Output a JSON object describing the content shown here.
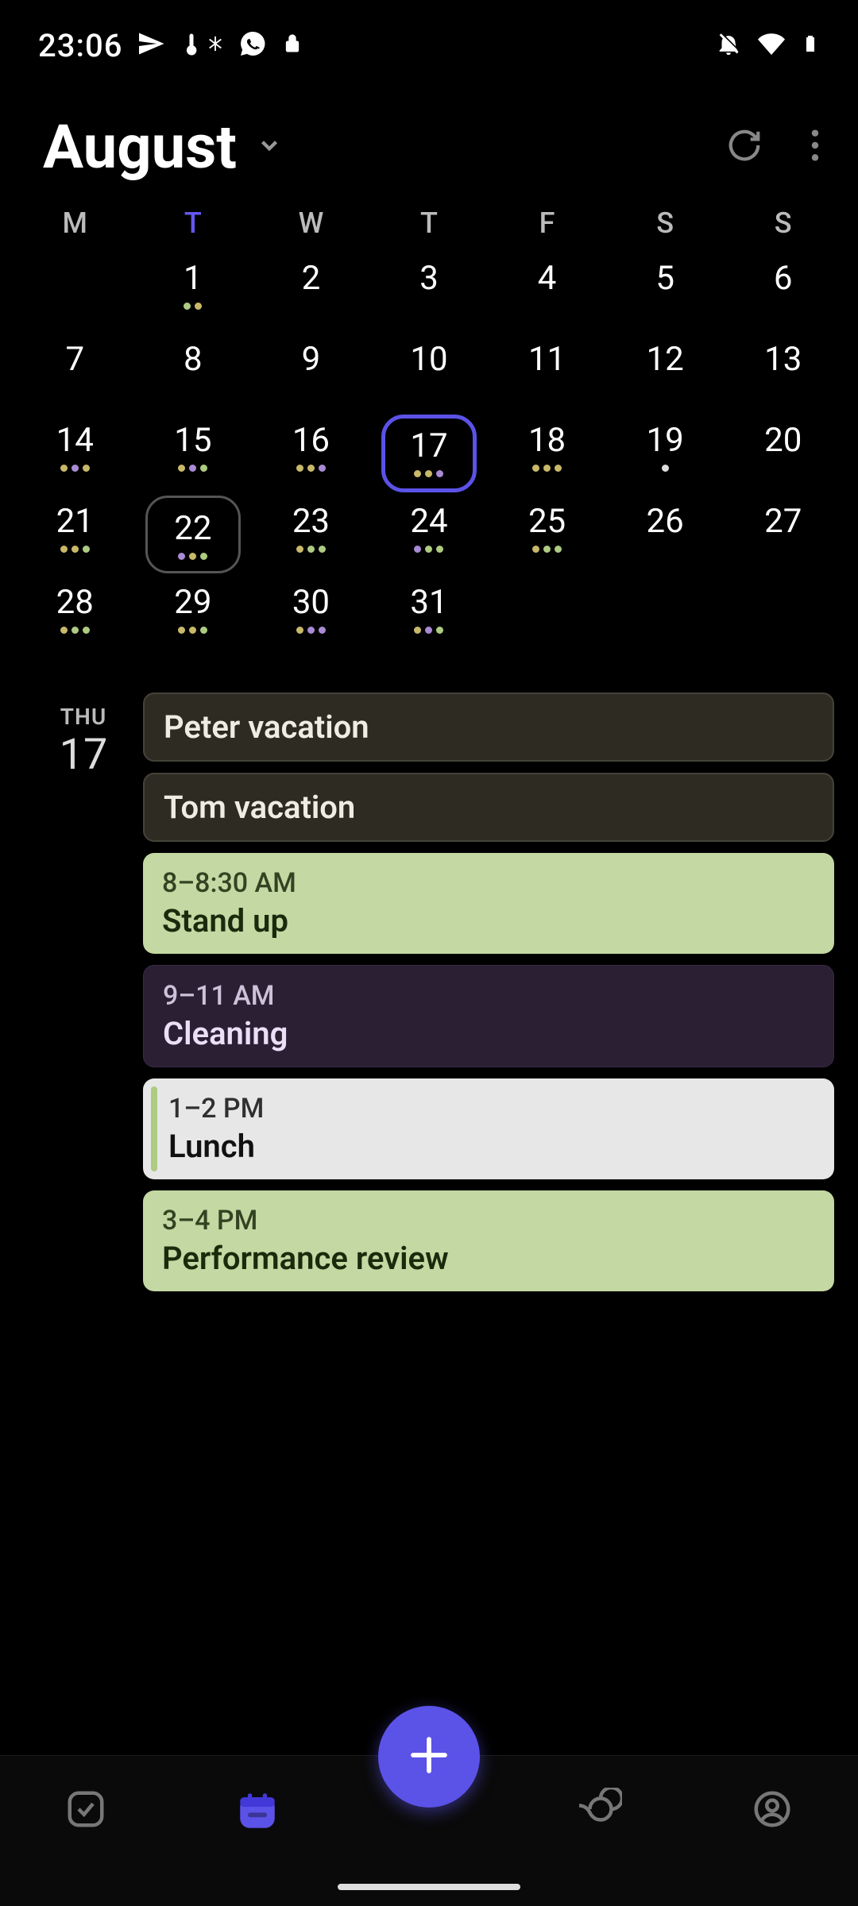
{
  "status": {
    "time": "23:06",
    "icons_left": [
      "telegram",
      "thermometer",
      "snowflake",
      "whatsapp",
      "lock"
    ],
    "icons_right": [
      "notifications-off",
      "wifi",
      "battery"
    ]
  },
  "header": {
    "month": "August",
    "sync_icon": "sync",
    "overflow_icon": "more-vert"
  },
  "weekdays": [
    "M",
    "T",
    "W",
    "T",
    "F",
    "S",
    "S"
  ],
  "today_weekday_index": 1,
  "calendar": {
    "rows": [
      [
        {
          "n": ""
        },
        {
          "n": "1",
          "dots": [
            "green",
            "olive"
          ]
        },
        {
          "n": "2"
        },
        {
          "n": "3"
        },
        {
          "n": "4"
        },
        {
          "n": "5"
        },
        {
          "n": "6"
        }
      ],
      [
        {
          "n": "7"
        },
        {
          "n": "8"
        },
        {
          "n": "9"
        },
        {
          "n": "10"
        },
        {
          "n": "11"
        },
        {
          "n": "12"
        },
        {
          "n": "13"
        }
      ],
      [
        {
          "n": "14",
          "dots": [
            "olive",
            "purple",
            "olive"
          ]
        },
        {
          "n": "15",
          "dots": [
            "olive",
            "purple",
            "green"
          ]
        },
        {
          "n": "16",
          "dots": [
            "olive",
            "olive",
            "purple"
          ]
        },
        {
          "n": "17",
          "today": true,
          "dots": [
            "olive",
            "olive",
            "purple"
          ]
        },
        {
          "n": "18",
          "dots": [
            "olive",
            "olive",
            "olive"
          ]
        },
        {
          "n": "19",
          "dots": [
            "white"
          ]
        },
        {
          "n": "20"
        }
      ],
      [
        {
          "n": "21",
          "dots": [
            "olive",
            "olive",
            "green"
          ]
        },
        {
          "n": "22",
          "outlined": true,
          "dots": [
            "purple",
            "olive",
            "green"
          ]
        },
        {
          "n": "23",
          "dots": [
            "olive",
            "green",
            "green"
          ]
        },
        {
          "n": "24",
          "dots": [
            "purple",
            "green",
            "green"
          ]
        },
        {
          "n": "25",
          "dots": [
            "olive",
            "green",
            "green"
          ]
        },
        {
          "n": "26"
        },
        {
          "n": "27"
        }
      ],
      [
        {
          "n": "28",
          "dots": [
            "olive",
            "green",
            "green"
          ]
        },
        {
          "n": "29",
          "dots": [
            "olive",
            "olive",
            "green"
          ]
        },
        {
          "n": "30",
          "dots": [
            "olive",
            "purple",
            "purple"
          ]
        },
        {
          "n": "31",
          "dots": [
            "olive",
            "purple",
            "green"
          ]
        },
        {
          "n": ""
        },
        {
          "n": ""
        },
        {
          "n": ""
        }
      ]
    ]
  },
  "selected_day": {
    "weekday": "THU",
    "day": "17",
    "events": [
      {
        "title": "Peter vacation",
        "style": "neutral-dark"
      },
      {
        "title": "Tom vacation",
        "style": "neutral-dark"
      },
      {
        "time": "8–8:30 AM",
        "title": "Stand up",
        "style": "green"
      },
      {
        "time": "9–11 AM",
        "title": "Cleaning",
        "style": "purple"
      },
      {
        "time": "1–2 PM",
        "title": "Lunch",
        "style": "white"
      },
      {
        "time": "3–4 PM",
        "title": "Performance review",
        "style": "green"
      }
    ]
  },
  "fab_icon": "plus",
  "nav": {
    "items": [
      "tasks",
      "calendar",
      "spacer",
      "loop",
      "profile"
    ],
    "active_index": 1
  },
  "colors": {
    "accent": "#5b52e8",
    "event_green": "#c3d8a2",
    "event_purple": "#2a1f33",
    "event_white": "#e7e7e7",
    "event_neutral": "#2d2b22"
  }
}
